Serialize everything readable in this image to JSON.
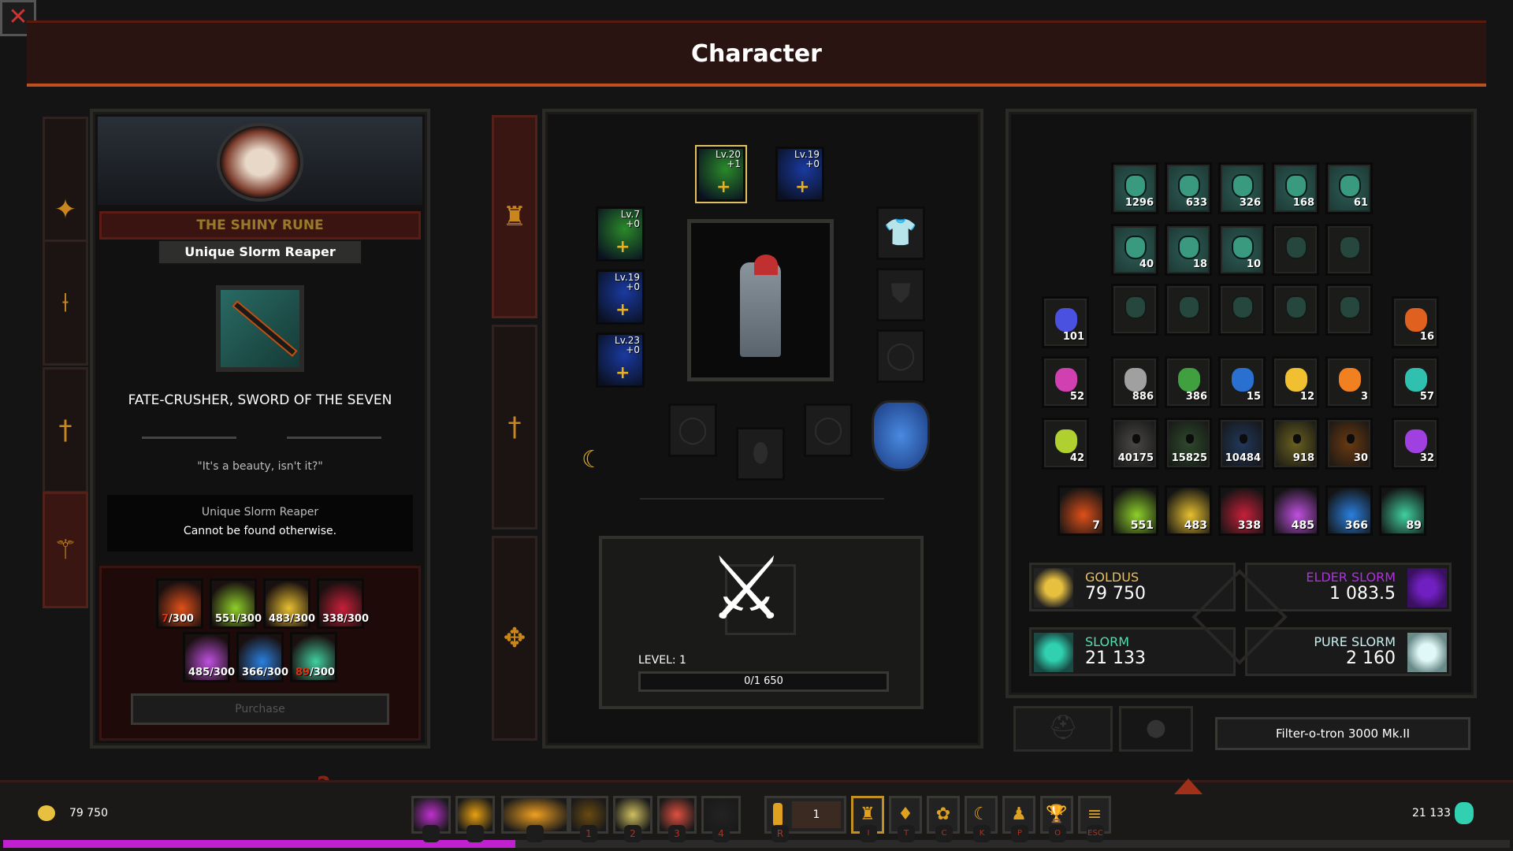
{
  "window": {
    "title": "Character",
    "close_icon": "close-x-icon"
  },
  "left_tabs": [
    "flame-icon",
    "staff-icon",
    "sword-icon",
    "axe-icon"
  ],
  "left_tabs_active": 3,
  "shop": {
    "name": "THE SHINY RUNE",
    "item_type": "Unique Slorm Reaper",
    "item_name": "FATE-CRUSHER, SWORD OF THE SEVEN",
    "quote": "\"It's a beauty, isn't it?\"",
    "desc_line1": "Unique Slorm Reaper",
    "desc_line2": "Cannot be found otherwise.",
    "costs": [
      {
        "have": "7",
        "need": "/300",
        "insufficient": true,
        "color": "#e0501a"
      },
      {
        "have": "551",
        "need": "/300",
        "insufficient": false,
        "color": "#8ed02a"
      },
      {
        "have": "483",
        "need": "/300",
        "insufficient": false,
        "color": "#e8c030"
      },
      {
        "have": "338",
        "need": "/300",
        "insufficient": false,
        "color": "#c8203a"
      },
      {
        "have": "485",
        "need": "/300",
        "insufficient": false,
        "color": "#c050e0"
      },
      {
        "have": "366",
        "need": "/300",
        "insufficient": false,
        "color": "#2a80e0"
      },
      {
        "have": "89",
        "need": "/300",
        "insufficient": true,
        "color": "#40d0a0"
      }
    ],
    "purchase_label": "Purchase",
    "help_icon": "question-mark-icon"
  },
  "center_tabs": [
    "lantern-icon",
    "sword-icon",
    "amulet-icon"
  ],
  "equipment": {
    "items": [
      {
        "slot": "weapon-top-left",
        "level": "Lv.20",
        "plus": "+1",
        "color": "#2a8a2a",
        "selected": true
      },
      {
        "slot": "weapon-top-right",
        "level": "Lv.19",
        "plus": "+0",
        "color": "#1a3aa0",
        "selected": false
      },
      {
        "slot": "helmet",
        "level": "Lv.7",
        "plus": "+0",
        "color": "#2a8a2a",
        "selected": false
      },
      {
        "slot": "shoulders",
        "level": "Lv.19",
        "plus": "+0",
        "color": "#1a3aa0",
        "selected": false
      },
      {
        "slot": "gloves",
        "level": "Lv.23",
        "plus": "+0",
        "color": "#1a3aa0",
        "selected": false
      }
    ],
    "empty_slots": [
      "body-armor-slot-icon",
      "cape-slot-icon",
      "belt-slot-icon",
      "ring-slot-icon",
      "boots-slot-icon",
      "ring-slot-icon"
    ],
    "level_label": "LEVEL: 1",
    "xp_text": "0/1 650",
    "xp_fraction": 0
  },
  "inventory": {
    "fragments": [
      [
        "1296",
        "633",
        "326",
        "168",
        "61"
      ],
      [
        "40",
        "18",
        "10",
        "",
        ""
      ],
      [
        "",
        "",
        "",
        "",
        ""
      ]
    ],
    "side_left": [
      {
        "count": "101",
        "color": "#4a50e0"
      },
      {
        "count": "52",
        "color": "#d040b0"
      },
      {
        "count": "42",
        "color": "#b0d030"
      }
    ],
    "side_right": [
      {
        "count": "16",
        "color": "#e06020"
      },
      {
        "count": "57",
        "color": "#30c0b0"
      },
      {
        "count": "32",
        "color": "#a040e0"
      }
    ],
    "row4": [
      {
        "count": "886",
        "color": "#a0a0a0"
      },
      {
        "count": "386",
        "color": "#40a040"
      },
      {
        "count": "15",
        "color": "#2a70d0"
      },
      {
        "count": "12",
        "color": "#f0c030"
      },
      {
        "count": "3",
        "color": "#f08020"
      }
    ],
    "row5": [
      {
        "count": "40175",
        "color": "#4a4846"
      },
      {
        "count": "15825",
        "color": "#2e4a2c"
      },
      {
        "count": "10484",
        "color": "#22385a"
      },
      {
        "count": "918",
        "color": "#6a6020"
      },
      {
        "count": "30",
        "color": "#6a3a12"
      }
    ],
    "elements": [
      {
        "count": "7",
        "color": "#e0501a"
      },
      {
        "count": "551",
        "color": "#8ed02a"
      },
      {
        "count": "483",
        "color": "#e8c030"
      },
      {
        "count": "338",
        "color": "#c8203a"
      },
      {
        "count": "485",
        "color": "#c050e0"
      },
      {
        "count": "366",
        "color": "#2a80e0"
      },
      {
        "count": "89",
        "color": "#40d0a0"
      }
    ]
  },
  "currencies": {
    "goldus": {
      "label": "GOLDUS",
      "value": "79 750",
      "color": "#e8c060"
    },
    "elder_slorm": {
      "label": "ELDER SLORM",
      "value": "1 083.5",
      "color": "#b030e0"
    },
    "slorm": {
      "label": "SLORM",
      "value": "21 133",
      "color": "#50e0b0"
    },
    "pure_slorm": {
      "label": "PURE SLORM",
      "value": "2 160",
      "color": "#c8f0f0"
    }
  },
  "filter_button": "Filter-o-tron 3000 Mk.II",
  "bottom_bar": {
    "gold": "79 750",
    "slorm": "21 133",
    "xp_fraction": 0.34,
    "xp_color": "#c020d0",
    "skills": [
      {
        "key": "",
        "color": "#c030d0"
      },
      {
        "key": "",
        "color": "#e8a010"
      },
      {
        "key": "",
        "color": "#f0a020"
      },
      {
        "key": "1",
        "color": "#6a4a10"
      },
      {
        "key": "2",
        "color": "#d0c060"
      },
      {
        "key": "3",
        "color": "#e05040"
      },
      {
        "key": "4",
        "color": "#222222"
      }
    ],
    "potion_key": "R",
    "potion_count": "1",
    "menu": [
      {
        "key": "I",
        "icon": "inventory-bag-icon"
      },
      {
        "key": "T",
        "icon": "talent-icon"
      },
      {
        "key": "C",
        "icon": "character-icon"
      },
      {
        "key": "K",
        "icon": "skills-moon-icon"
      },
      {
        "key": "P",
        "icon": "people-icon"
      },
      {
        "key": "O",
        "icon": "trophy-icon"
      },
      {
        "key": "ESC",
        "icon": "menu-icon"
      }
    ]
  }
}
